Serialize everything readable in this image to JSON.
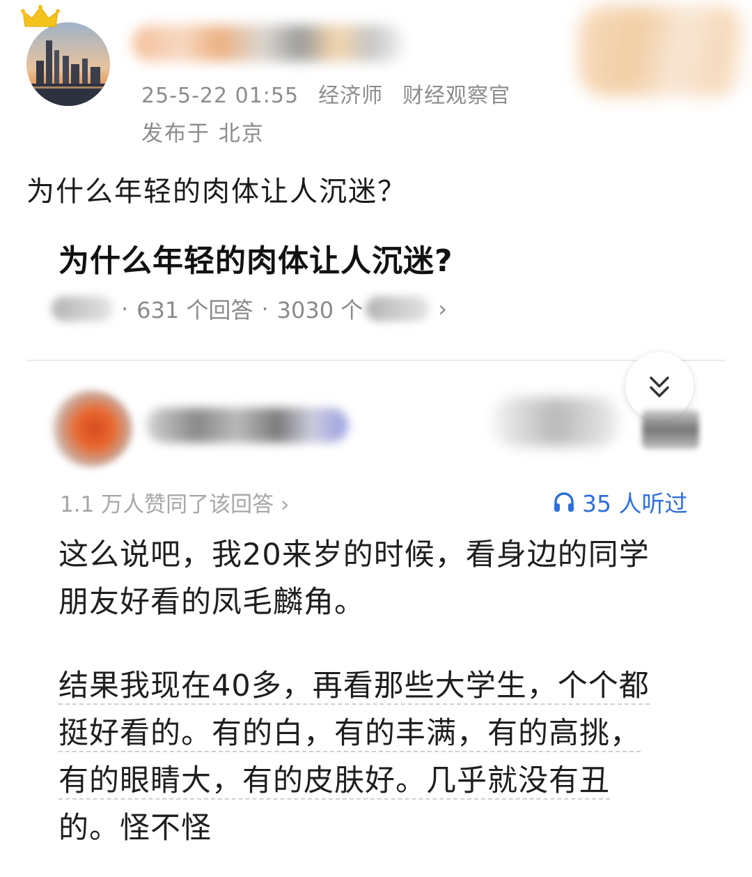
{
  "post": {
    "meta_time": "25-5-22 01:55",
    "meta_tag1": "经济师",
    "meta_tag2": "财经观察官",
    "location": "发布于 北京",
    "text": "为什么年轻的肉体让人沉迷？"
  },
  "question": {
    "title": "为什么年轻的肉体让人沉迷?",
    "sep": "·",
    "answers": "631 个回答",
    "follows_prefix": "3030 个",
    "chevron": "›"
  },
  "answer": {
    "likes": "1.1 万人赞同了该回答 ›",
    "listened": "35 人听过",
    "para1_line1": "这么说吧，我20来岁的时候，看身边的同学",
    "para1_line2": "朋友好看的凤毛麟角。",
    "para2_line1": "结果我现在40多，再看那些大学生，个个都",
    "para2_line2": "挺好看的。有的白，有的丰满，有的高挑，",
    "para2_line3": "有的眼睛大，有的皮肤好。几乎就没有丑",
    "para2_line4": "的。怪不怪"
  },
  "colors": {
    "accent": "#2f6fd9",
    "muted": "#8c8c8c"
  },
  "icons": [
    "crown-icon",
    "chevron-double-down-icon",
    "headphones-icon"
  ]
}
